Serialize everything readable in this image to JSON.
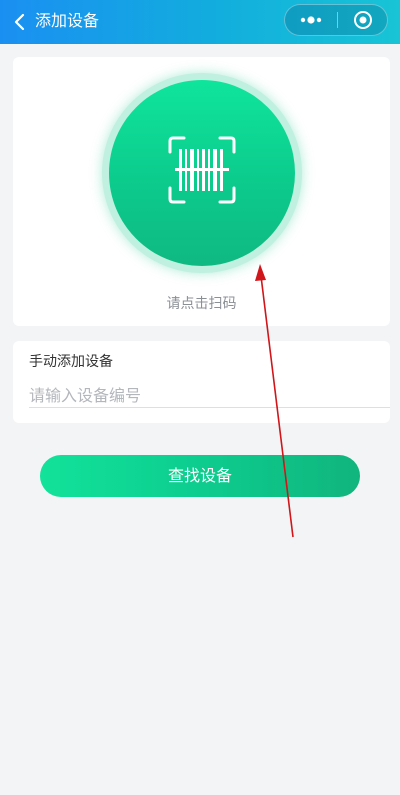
{
  "header": {
    "title": "添加设备",
    "back_icon": "chevron-left-icon",
    "more_icon": "more-dots-icon",
    "close_icon": "target-circle-icon"
  },
  "scan": {
    "icon": "barcode-scan-icon",
    "hint": "请点击扫码"
  },
  "manual": {
    "label": "手动添加设备",
    "placeholder": "请输入设备编号",
    "value": ""
  },
  "actions": {
    "find_label": "查找设备"
  },
  "colors": {
    "header_start": "#1a8ff2",
    "header_end": "#18c4d6",
    "accent_green": "#0ccb8c",
    "annotation_red": "#d0161a",
    "background": "#f3f4f6"
  }
}
